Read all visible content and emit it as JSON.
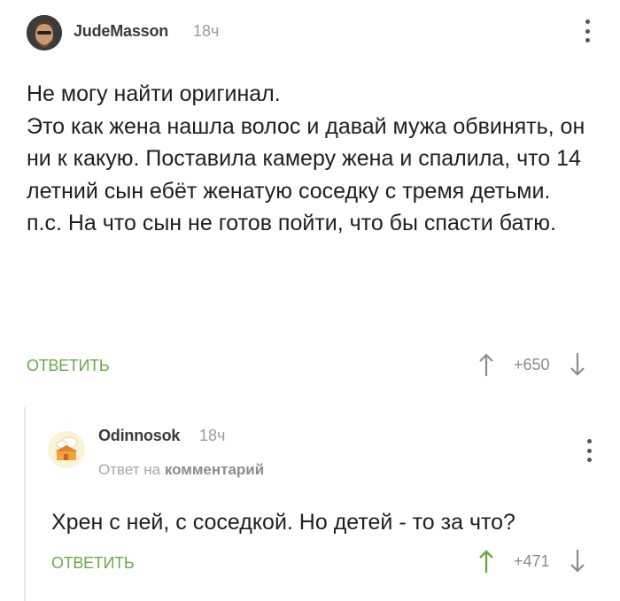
{
  "comment": {
    "username": "JudeMasson",
    "time": "18ч",
    "text": "Не могу найти оригинал.\nЭто как жена нашла волос и давай мужа обвинять, он ни к какую. Поставила камеру жена и спалила, что 14 летний сын ебёт женатую соседку с тремя детьми.\nп.с. На что сын не готов пойти, что бы спасти батю.",
    "reply_label": "ОТВЕТИТЬ",
    "rating": "+650"
  },
  "reply": {
    "username": "Odinnosok",
    "time": "18ч",
    "reply_to_prefix": "Ответ на",
    "reply_to_target": "комментарий",
    "text": "Хрен с ней, с соседкой. Но детей - то за что?",
    "reply_label": "ОТВЕТИТЬ",
    "rating": "+471"
  },
  "colors": {
    "accent": "#6aa94a",
    "upvote_active": "#6aa94a",
    "muted": "#9b9b9b"
  },
  "icons": {
    "menu": "more-vertical-icon",
    "upvote": "arrow-up-icon",
    "downvote": "arrow-down-icon"
  }
}
